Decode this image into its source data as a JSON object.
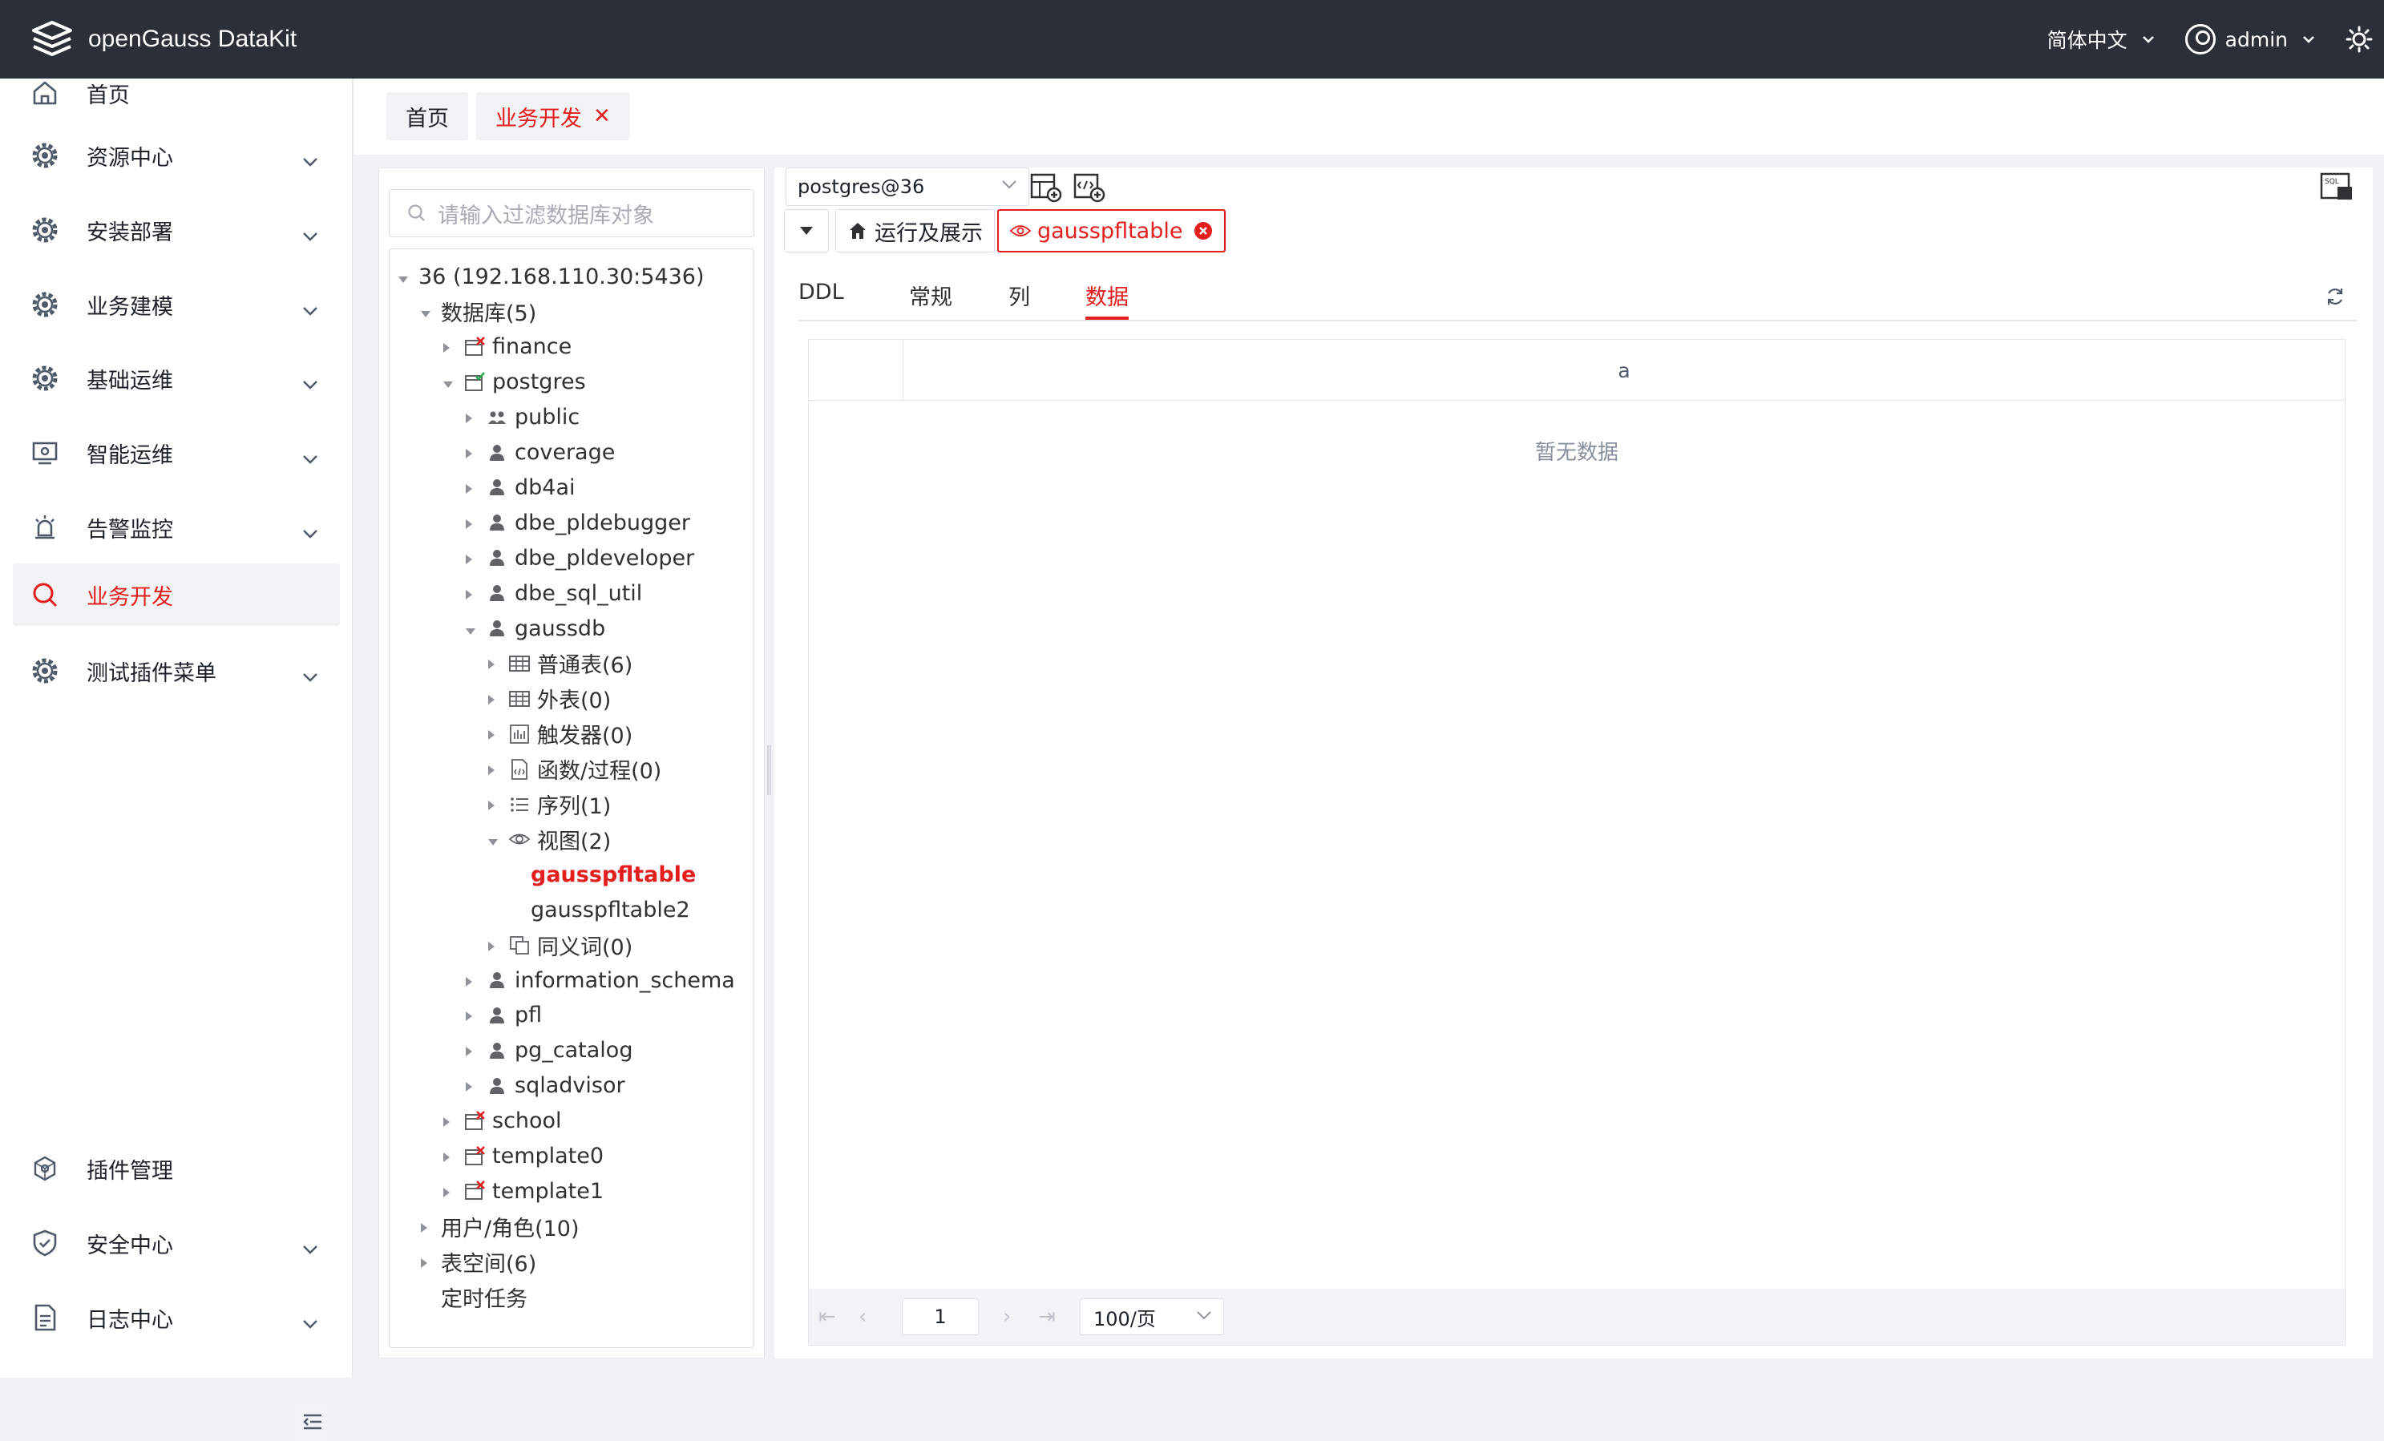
{
  "header": {
    "app_name": "openGauss DataKit",
    "language": "简体中文",
    "user": "admin"
  },
  "sidebar": {
    "items": [
      {
        "label": "首页",
        "icon": "home-icon",
        "expandable": false,
        "active": false
      },
      {
        "label": "资源中心",
        "icon": "gear-icon",
        "expandable": true,
        "active": false
      },
      {
        "label": "安装部署",
        "icon": "gear-icon",
        "expandable": true,
        "active": false
      },
      {
        "label": "业务建模",
        "icon": "gear-icon",
        "expandable": true,
        "active": false
      },
      {
        "label": "基础运维",
        "icon": "gear-icon",
        "expandable": true,
        "active": false
      },
      {
        "label": "智能运维",
        "icon": "monitor-icon",
        "expandable": true,
        "active": false
      },
      {
        "label": "告警监控",
        "icon": "alarm-icon",
        "expandable": true,
        "active": false
      },
      {
        "label": "业务开发",
        "icon": "search-icon",
        "expandable": false,
        "active": true
      },
      {
        "label": "测试插件菜单",
        "icon": "gear-icon",
        "expandable": true,
        "active": false
      },
      {
        "label": "插件管理",
        "icon": "plugin-icon",
        "expandable": false,
        "active": false
      },
      {
        "label": "安全中心",
        "icon": "shield-icon",
        "expandable": true,
        "active": false
      },
      {
        "label": "日志中心",
        "icon": "log-icon",
        "expandable": true,
        "active": false
      }
    ]
  },
  "page_tabs": [
    {
      "label": "首页",
      "active": false,
      "closable": false
    },
    {
      "label": "业务开发",
      "active": true,
      "closable": true
    }
  ],
  "tree": {
    "search_placeholder": "请输入过滤数据库对象",
    "nodes": [
      {
        "label": "36 (192.168.110.30:5436)",
        "depth": 0,
        "state": "open",
        "icon": ""
      },
      {
        "label": "数据库(5)",
        "depth": 1,
        "state": "open",
        "icon": ""
      },
      {
        "label": "finance",
        "depth": 2,
        "state": "closed",
        "icon": "db-off-icon"
      },
      {
        "label": "postgres",
        "depth": 2,
        "state": "open",
        "icon": "db-on-icon"
      },
      {
        "label": "public",
        "depth": 3,
        "state": "closed",
        "icon": "users-icon"
      },
      {
        "label": "coverage",
        "depth": 3,
        "state": "closed",
        "icon": "user-icon"
      },
      {
        "label": "db4ai",
        "depth": 3,
        "state": "closed",
        "icon": "user-icon"
      },
      {
        "label": "dbe_pldebugger",
        "depth": 3,
        "state": "closed",
        "icon": "user-icon"
      },
      {
        "label": "dbe_pldeveloper",
        "depth": 3,
        "state": "closed",
        "icon": "user-icon"
      },
      {
        "label": "dbe_sql_util",
        "depth": 3,
        "state": "closed",
        "icon": "user-icon"
      },
      {
        "label": "gaussdb",
        "depth": 3,
        "state": "open",
        "icon": "user-icon"
      },
      {
        "label": "普通表(6)",
        "depth": 4,
        "state": "closed",
        "icon": "table-icon"
      },
      {
        "label": "外表(0)",
        "depth": 4,
        "state": "closed",
        "icon": "table-icon"
      },
      {
        "label": "触发器(0)",
        "depth": 4,
        "state": "closed",
        "icon": "trigger-icon"
      },
      {
        "label": "函数/过程(0)",
        "depth": 4,
        "state": "closed",
        "icon": "function-icon"
      },
      {
        "label": "序列(1)",
        "depth": 4,
        "state": "closed",
        "icon": "list-icon"
      },
      {
        "label": "视图(2)",
        "depth": 4,
        "state": "open",
        "icon": "eye-icon"
      },
      {
        "label": "gausspfltable",
        "depth": 5,
        "state": "leaf",
        "icon": "",
        "selected": true
      },
      {
        "label": "gausspfltable2",
        "depth": 5,
        "state": "leaf",
        "icon": ""
      },
      {
        "label": "同义词(0)",
        "depth": 4,
        "state": "closed",
        "icon": "synonym-icon"
      },
      {
        "label": "information_schema",
        "depth": 3,
        "state": "closed",
        "icon": "user-icon"
      },
      {
        "label": "pfl",
        "depth": 3,
        "state": "closed",
        "icon": "user-icon"
      },
      {
        "label": "pg_catalog",
        "depth": 3,
        "state": "closed",
        "icon": "user-icon"
      },
      {
        "label": "sqladvisor",
        "depth": 3,
        "state": "closed",
        "icon": "user-icon"
      },
      {
        "label": "school",
        "depth": 2,
        "state": "closed",
        "icon": "db-off-icon"
      },
      {
        "label": "template0",
        "depth": 2,
        "state": "closed",
        "icon": "db-off-icon"
      },
      {
        "label": "template1",
        "depth": 2,
        "state": "closed",
        "icon": "db-off-icon"
      },
      {
        "label": "用户/角色(10)",
        "depth": 1,
        "state": "closed",
        "icon": ""
      },
      {
        "label": "表空间(6)",
        "depth": 1,
        "state": "closed",
        "icon": ""
      },
      {
        "label": "定时任务",
        "depth": 1,
        "state": "leaf",
        "icon": ""
      }
    ]
  },
  "editor": {
    "connection": "postgres@36",
    "tabs": [
      {
        "label": "运行及展示",
        "icon": "house-icon",
        "active": false
      },
      {
        "label": "gausspfltable",
        "icon": "eye-icon",
        "active": true
      }
    ],
    "sub_tabs": [
      "DDL",
      "常规",
      "列",
      "数据"
    ],
    "active_sub_tab": "数据",
    "columns": [
      "a"
    ],
    "empty_text": "暂无数据",
    "pagination": {
      "page": "1",
      "page_size": "100/页"
    }
  },
  "colors": {
    "accent": "#e41d1d",
    "header_bg": "#2b2f38"
  }
}
